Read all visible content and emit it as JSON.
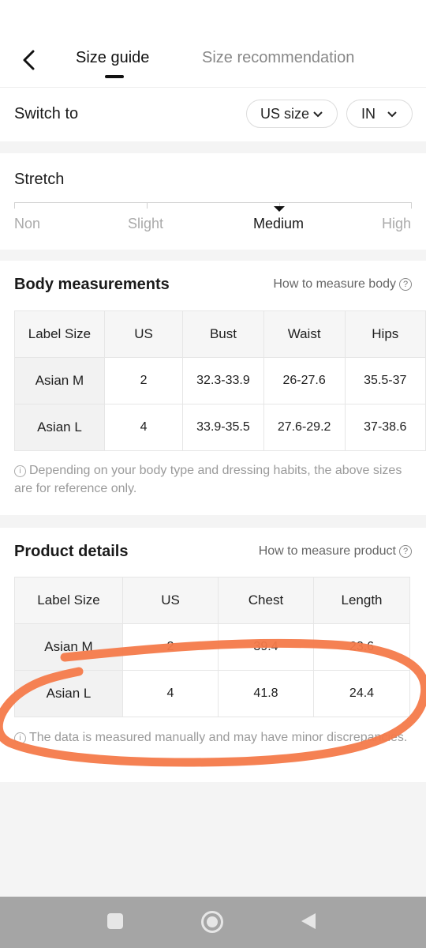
{
  "header": {
    "tab_guide": "Size guide",
    "tab_recommendation": "Size recommendation"
  },
  "switch": {
    "label": "Switch to",
    "size_system": "US size",
    "unit": "IN"
  },
  "stretch": {
    "title": "Stretch",
    "levels": [
      "Non",
      "Slight",
      "Medium",
      "High"
    ],
    "selected": "Medium"
  },
  "body_measurements": {
    "title": "Body measurements",
    "help_link": "How to measure body",
    "columns": [
      "Label Size",
      "US",
      "Bust",
      "Waist",
      "Hips"
    ],
    "rows": [
      [
        "Asian M",
        "2",
        "32.3-33.9",
        "26-27.6",
        "35.5-37"
      ],
      [
        "Asian L",
        "4",
        "33.9-35.5",
        "27.6-29.2",
        "37-38.6"
      ]
    ],
    "note": "Depending on your body type and dressing habits, the above sizes are for reference only."
  },
  "product_details": {
    "title": "Product details",
    "help_link": "How to measure product",
    "columns": [
      "Label Size",
      "US",
      "Chest",
      "Length"
    ],
    "rows": [
      [
        "Asian M",
        "2",
        "39.4",
        "23.6"
      ],
      [
        "Asian L",
        "4",
        "41.8",
        "24.4"
      ]
    ],
    "note": "The data is measured manually and may have minor discrepancies."
  },
  "annotation": {
    "color": "#f47a4a"
  },
  "navbar": {
    "icons": [
      "square-icon",
      "home-circle-icon",
      "back-triangle-icon"
    ]
  }
}
